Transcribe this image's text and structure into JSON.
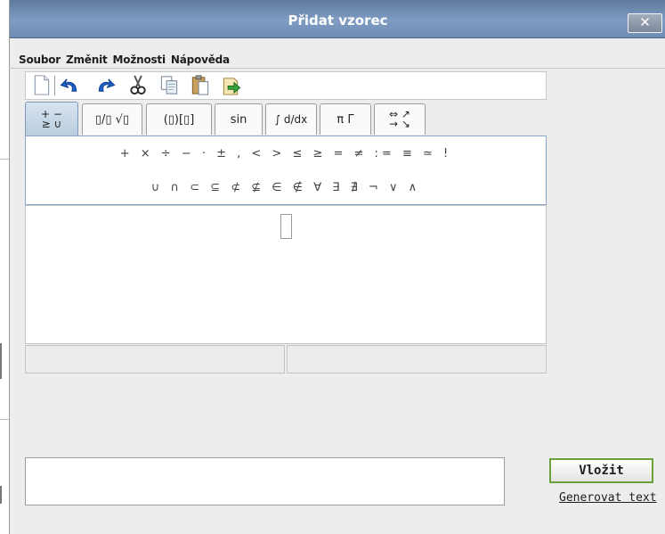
{
  "window": {
    "title": "Přidat vzorec",
    "close_label": "✕"
  },
  "menu": {
    "items": [
      "Soubor",
      "Změnit",
      "Možnosti",
      "Nápověda"
    ]
  },
  "toolbar": {
    "icons": [
      "new-icon",
      "undo-icon",
      "redo-icon",
      "cut-icon",
      "copy-icon",
      "paste-icon",
      "import-icon"
    ]
  },
  "tabs": [
    {
      "label": "+ −\n≥ ∪"
    },
    {
      "label": "▯/▯ √▯"
    },
    {
      "label": "(▯)[▯]"
    },
    {
      "label": "sin"
    },
    {
      "label": "∫ d/dx"
    },
    {
      "label": "π Γ"
    },
    {
      "label": "⇔ ↗\n→ ↘"
    }
  ],
  "symbols": {
    "row1": "+ × ÷ − · ± , < > ≤ ≥ = ≠ := ≡ ≃ !",
    "row2": "∪ ∩ ⊂ ⊆ ⊄ ⊈ ∈ ∉ ∀ ∃ ∄ ¬ ∨ ∧"
  },
  "actions": {
    "insert_label": "Vložit",
    "generate_label": "Generovat text"
  },
  "colors": {
    "title_bar": "#7f9cc3",
    "insert_border": "#6aa13b",
    "active_tab": "#c9d9ea"
  }
}
